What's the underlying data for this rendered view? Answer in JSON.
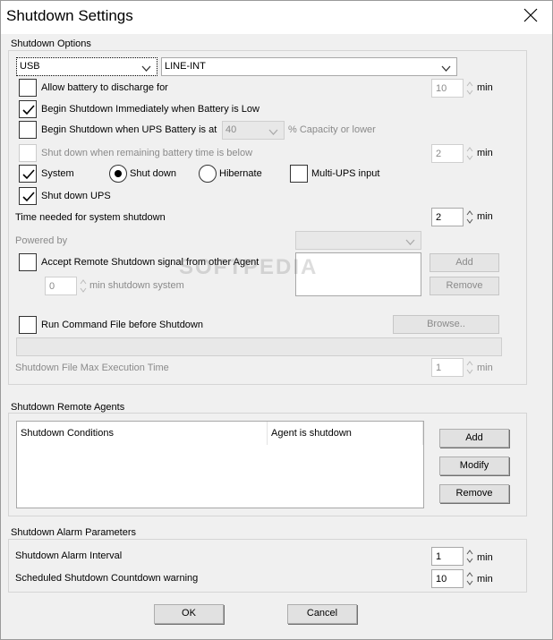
{
  "window": {
    "title": "Shutdown Settings"
  },
  "options": {
    "group_title": "Shutdown Options",
    "connection_type": "USB",
    "ups_model": "LINE-INT",
    "allow_discharge_label": "Allow battery to discharge for",
    "allow_discharge_value": "10",
    "begin_low_label": "Begin Shutdown Immediately when Battery is Low",
    "begin_at_label": "Begin Shutdown when UPS Battery is at",
    "capacity_value": "40",
    "capacity_suffix": "% Capacity or lower",
    "remaining_time_label": "Shut down when remaining battery time is below",
    "remaining_time_value": "2",
    "system_label": "System",
    "shutdown_radio_label": "Shut down",
    "hibernate_radio_label": "Hibernate",
    "multi_ups_label": "Multi-UPS input",
    "shutdown_ups_label": "Shut down UPS",
    "time_needed_label": "Time needed for system shutdown",
    "time_needed_value": "2",
    "powered_by_label": "Powered by",
    "accept_remote_label": "Accept Remote Shutdown signal from other Agent",
    "remote_min_value": "0",
    "remote_min_label": "min shutdown system",
    "add_label": "Add",
    "remove_label": "Remove",
    "run_command_label": "Run Command File before Shutdown",
    "browse_label": "Browse..",
    "max_exec_label": "Shutdown File Max Execution Time",
    "max_exec_value": "1",
    "min_unit": "min"
  },
  "remote_agents": {
    "group_title": "Shutdown Remote Agents",
    "columns": [
      "Shutdown Conditions",
      "Agent is shutdown"
    ],
    "add_label": "Add",
    "modify_label": "Modify",
    "remove_label": "Remove"
  },
  "alarm": {
    "group_title": "Shutdown Alarm Parameters",
    "interval_label": "Shutdown Alarm Interval",
    "interval_value": "1",
    "countdown_label": "Scheduled Shutdown Countdown warning",
    "countdown_value": "10",
    "min_unit": "min"
  },
  "footer": {
    "ok_label": "OK",
    "cancel_label": "Cancel"
  },
  "watermark": "SOFTPEDIA"
}
